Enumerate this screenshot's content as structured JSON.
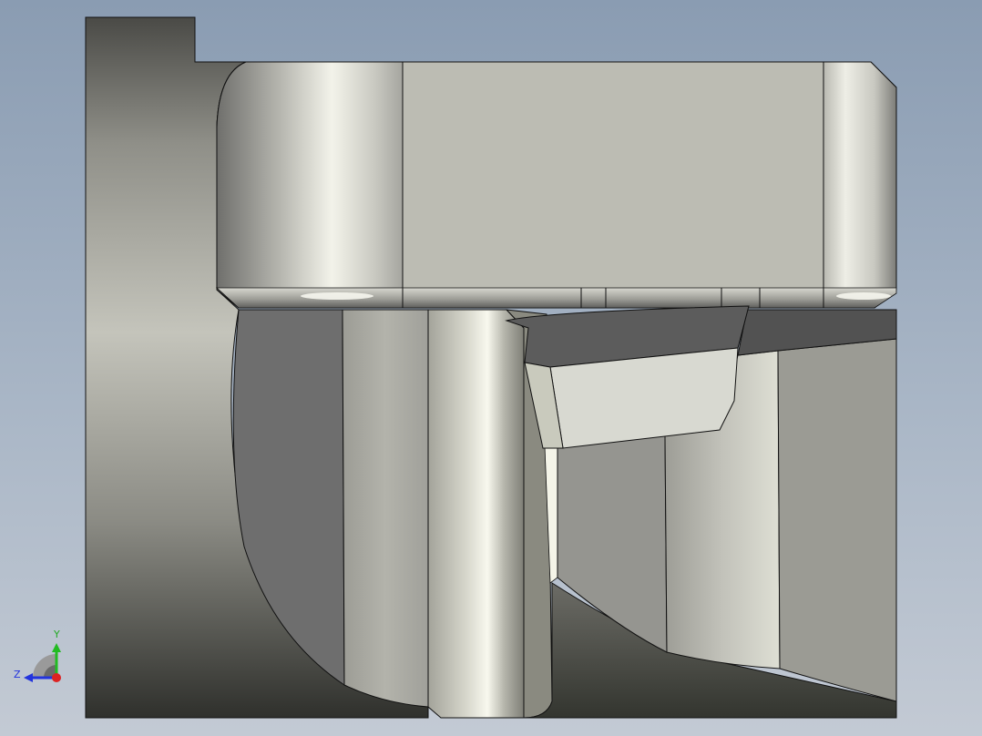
{
  "viewport": {
    "background_top": "#8a9cb2",
    "background_bottom": "#c3cad4"
  },
  "triad": {
    "y_label": "Y",
    "z_label": "Z",
    "y_axis_color": "#22bb22",
    "z_axis_color": "#2233dd",
    "x_axis_color": "#dd2222",
    "icon": "view-orientation-triad-icon"
  },
  "model": {
    "name": "cad-part-section-view",
    "colors": {
      "edge": "#111111",
      "light_face": "#c0c0b6",
      "dark_face": "#6c6c6c",
      "highlight": "#f2f2ea"
    }
  }
}
